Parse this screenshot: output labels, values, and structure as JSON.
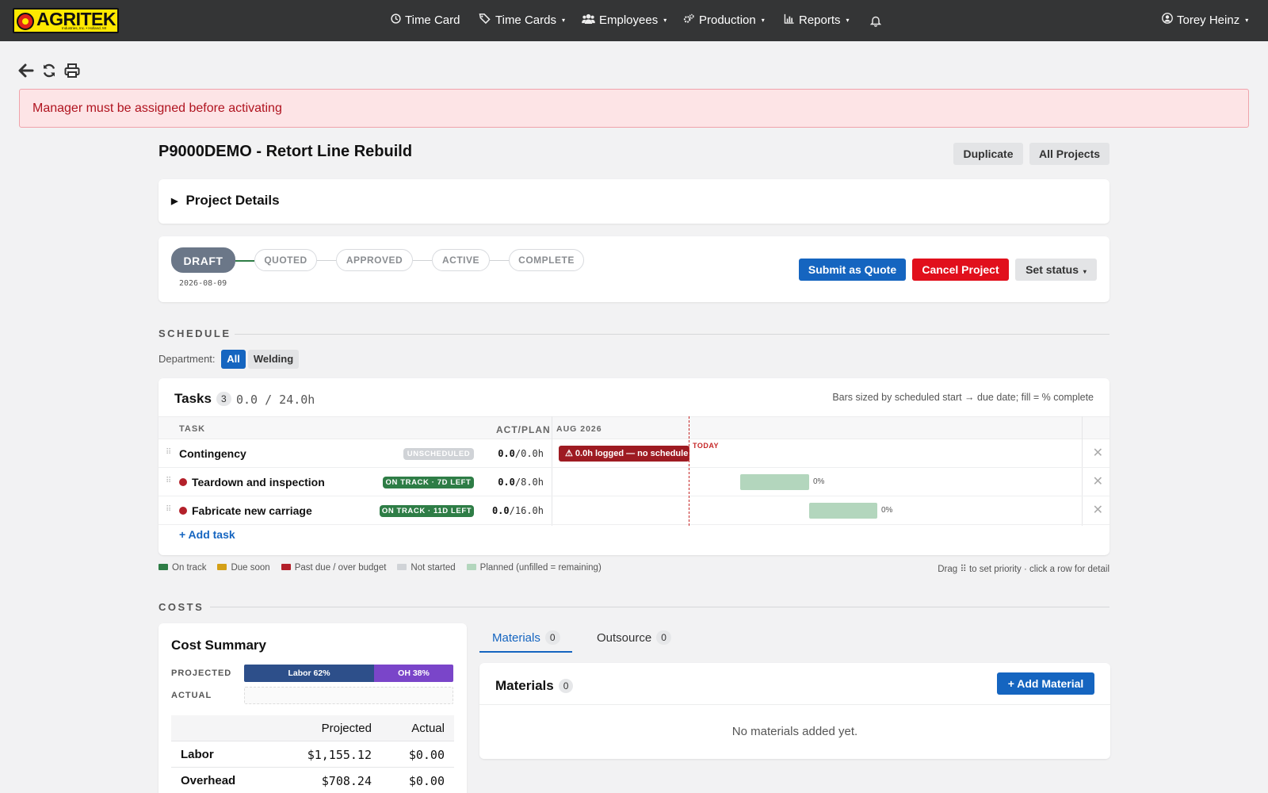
{
  "nav": {
    "logo_text": "AGRITEK",
    "logo_sub": "Industries, Inc. • Holland, MI",
    "items": [
      {
        "label": "Time Card",
        "icon": "clock-icon",
        "caret": false
      },
      {
        "label": "Time Cards",
        "icon": "tags-icon",
        "caret": true
      },
      {
        "label": "Employees",
        "icon": "users-icon",
        "caret": true
      },
      {
        "label": "Production",
        "icon": "gears-icon",
        "caret": true
      },
      {
        "label": "Reports",
        "icon": "bar-chart-icon",
        "caret": true
      }
    ],
    "user": "Torey Heinz"
  },
  "toolbar": {
    "icons": [
      "back-arrow-icon",
      "refresh-icon",
      "print-icon"
    ]
  },
  "alert": {
    "message": "Manager must be assigned before activating"
  },
  "project": {
    "title": "P9000DEMO - Retort Line Rebuild",
    "duplicate_label": "Duplicate",
    "all_projects_label": "All Projects",
    "details_label": "Project Details"
  },
  "status": {
    "steps": [
      "DRAFT",
      "QUOTED",
      "APPROVED",
      "ACTIVE",
      "COMPLETE"
    ],
    "current": "DRAFT",
    "current_date": "2026-08-09",
    "submit_label": "Submit as Quote",
    "cancel_label": "Cancel Project",
    "set_status_label": "Set status"
  },
  "schedule": {
    "section_label": "SCHEDULE",
    "department_label": "Department:",
    "departments": [
      "All",
      "Welding"
    ],
    "selected_department": "All",
    "tasks_label": "Tasks",
    "task_count": "3",
    "hours_summary": "0.0 / 24.0h",
    "hint": "Bars sized by scheduled start → due date; fill = % complete",
    "col_task": "TASK",
    "col_actplan": "ACT/PLAN",
    "month_label": "AUG 2026",
    "today_label": "TODAY",
    "tasks": [
      {
        "name": "Contingency",
        "badge": "UNSCHEDULED",
        "badge_color": "#d0d3d7",
        "act": "0.0",
        "plan": "/0.0h",
        "dot": false,
        "warning": "⚠ 0.0h logged — no schedule",
        "pct": null
      },
      {
        "name": "Teardown and inspection",
        "badge": "ON TRACK · 7D LEFT",
        "badge_color": "#2e7d46",
        "act": "0.0",
        "plan": "/8.0h",
        "dot": true,
        "warning": null,
        "pct": "0%"
      },
      {
        "name": "Fabricate new carriage",
        "badge": "ON TRACK · 11D LEFT",
        "badge_color": "#2e7d46",
        "act": "0.0",
        "plan": "/16.0h",
        "dot": true,
        "warning": null,
        "pct": "0%"
      }
    ],
    "add_task_label": "+ Add task",
    "legend": [
      {
        "label": "On track",
        "color": "#2e7d46"
      },
      {
        "label": "Due soon",
        "color": "#d4a017"
      },
      {
        "label": "Past due / over budget",
        "color": "#b3202a"
      },
      {
        "label": "Not started",
        "color": "#d0d3d7"
      },
      {
        "label": "Planned (unfilled = remaining)",
        "color": "#b3d6bd"
      }
    ],
    "legend_hint": "Drag ⠿ to set priority · click a row for detail"
  },
  "costs": {
    "section_label": "COSTS",
    "summary_title": "Cost Summary",
    "projected_label": "PROJECTED",
    "actual_label": "ACTUAL",
    "labor_seg": "Labor 62%",
    "oh_seg": "OH 38%",
    "labor_pct": 62,
    "oh_pct": 38,
    "table_headers": [
      "",
      "Projected",
      "Actual"
    ],
    "rows": [
      {
        "label": "Labor",
        "projected": "$1,155.12",
        "actual": "$0.00"
      },
      {
        "label": "Overhead",
        "projected": "$708.24",
        "actual": "$0.00"
      }
    ],
    "tabs": [
      {
        "label": "Materials",
        "count": "0"
      },
      {
        "label": "Outsource",
        "count": "0"
      }
    ],
    "materials_title": "Materials",
    "materials_count": "0",
    "add_material_label": "+ Add Material",
    "empty_text": "No materials added yet."
  },
  "colors": {
    "accent": "#1565c0",
    "danger": "#e1101c",
    "nav_bg": "#343536",
    "labor": "#2d4f8a",
    "overhead": "#7a45c9"
  }
}
